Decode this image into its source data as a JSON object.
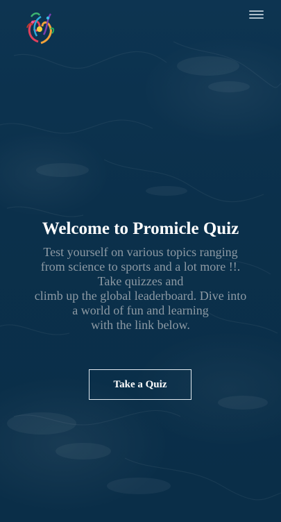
{
  "header": {
    "logo_icon": "colorful-paisley-logo",
    "menu_icon": "hamburger-menu-icon"
  },
  "hero": {
    "title": "Welcome to Promicle Quiz",
    "description_lines": [
      "Test yourself on various topics ranging",
      "from science to sports and a lot more !!.",
      "Take quizzes and",
      "climb up the global leaderboard. Dive into",
      "a world of fun and learning",
      "with the link below."
    ],
    "cta_label": "Take a Quiz"
  },
  "colors": {
    "background": "#0b304b",
    "title": "#ffffff",
    "description": "#8d9aa4",
    "button_border": "#e4ecf2"
  }
}
